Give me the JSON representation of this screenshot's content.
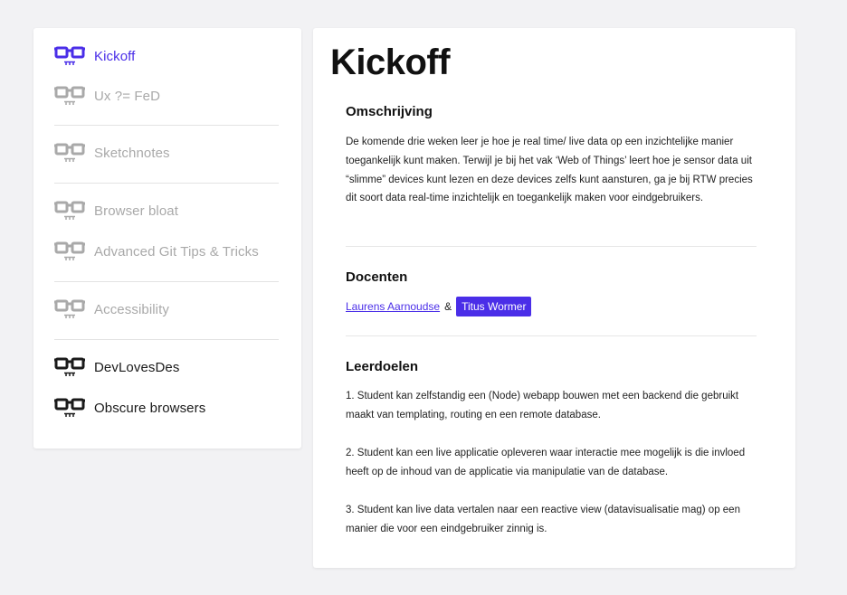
{
  "sidebar": {
    "items": [
      {
        "label": "Kickoff",
        "state": "active"
      },
      {
        "label": "Ux ?= FeD",
        "state": "inactive"
      },
      {
        "label": "Sketchnotes",
        "state": "inactive"
      },
      {
        "label": "Browser bloat",
        "state": "inactive"
      },
      {
        "label": "Advanced Git Tips & Tricks",
        "state": "inactive"
      },
      {
        "label": "Accessibility",
        "state": "inactive"
      },
      {
        "label": "DevLovesDes",
        "state": "upcoming"
      },
      {
        "label": "Obscure browsers",
        "state": "upcoming"
      }
    ]
  },
  "colors": {
    "accent": "#4a2ee8",
    "inactive": "#a9a9a9",
    "upcoming": "#1a1a1a",
    "background": "#f2f2f4"
  },
  "icons": {
    "nav": "glasses-icon"
  },
  "main": {
    "title": "Kickoff",
    "description": {
      "heading": "Omschrijving",
      "text": "De komende drie weken leer je hoe je real time/ live data op een inzichtelijke manier toegankelijk kunt maken. Terwijl je bij het vak ‘Web of Things’ leert hoe je sensor data uit “slimme” devices kunt lezen en deze devices zelfs kunt aansturen, ga je bij RTW precies dit soort data real-time inzichtelijk en toegankelijk maken voor eindgebruikers."
    },
    "teachers": {
      "heading": "Docenten",
      "first": "Laurens Aarnoudse",
      "separator": "&",
      "second": "Titus Wormer"
    },
    "goals": {
      "heading": "Leerdoelen",
      "items": [
        "1. Student kan zelfstandig een (Node) webapp bouwen met een backend die gebruikt maakt van templating, routing en een remote database.",
        "2. Student kan een live applicatie opleveren waar interactie mee mogelijk is die invloed heeft op de inhoud van de applicatie via manipulatie van de database.",
        "3. Student kan live data vertalen naar een reactive view (datavisualisatie mag) op een manier die voor een eindgebruiker zinnig is."
      ]
    }
  }
}
